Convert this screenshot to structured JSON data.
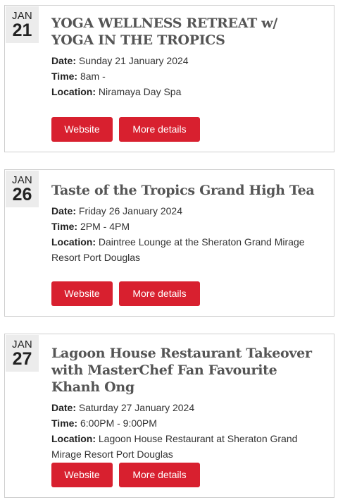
{
  "labels": {
    "date": "Date:",
    "time": "Time:",
    "location": "Location:",
    "website_button": "Website",
    "details_button": "More details"
  },
  "events": [
    {
      "month": "JAN",
      "day": "21",
      "title": "YOGA WELLNESS RETREAT w/ YOGA IN THE TROPICS",
      "date": "Sunday 21 January 2024",
      "time": "8am -",
      "location": "Niramaya Day Spa"
    },
    {
      "month": "JAN",
      "day": "26",
      "title": "Taste of the Tropics Grand High Tea",
      "date": "Friday 26 January 2024",
      "time": "2PM - 4PM",
      "location": "Daintree Lounge at the Sheraton Grand Mirage Resort Port Douglas"
    },
    {
      "month": "JAN",
      "day": "27",
      "title": "Lagoon House Restaurant Takeover with MasterChef Fan Favourite Khanh Ong",
      "date": "Saturday 27 January 2024",
      "time": "6:00PM - 9:00PM",
      "location": "Lagoon House Restaurant at Sheraton Grand Mirage Resort Port Douglas"
    }
  ],
  "colors": {
    "accent": "#d8202f",
    "badge_bg": "#ececec",
    "title": "#555555",
    "border": "#cfcfcf"
  }
}
